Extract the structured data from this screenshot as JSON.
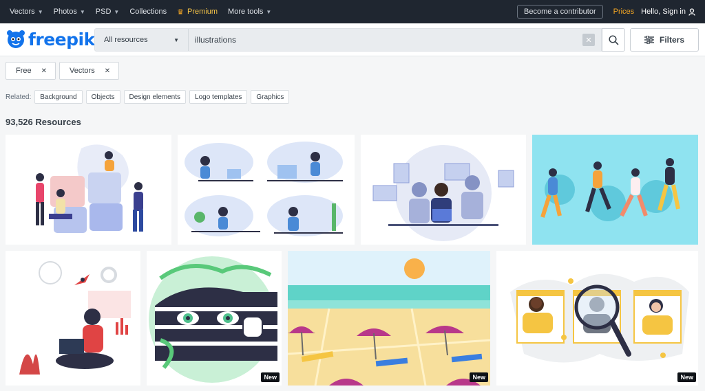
{
  "topnav": {
    "items": [
      {
        "label": "Vectors",
        "dropdown": true
      },
      {
        "label": "Photos",
        "dropdown": true
      },
      {
        "label": "PSD",
        "dropdown": true
      },
      {
        "label": "Collections",
        "dropdown": false
      }
    ],
    "premium_label": "Premium",
    "more_tools_label": "More tools",
    "contributor_label": "Become a contributor",
    "prices_label": "Prices",
    "signin_label": "Hello, Sign in"
  },
  "header": {
    "logo_text": "freepik",
    "resource_select": "All resources",
    "search_value": "illustrations",
    "filters_label": "Filters"
  },
  "chips": [
    {
      "label": "Free"
    },
    {
      "label": "Vectors"
    }
  ],
  "related": {
    "label": "Related:",
    "tags": [
      "Background",
      "Objects",
      "Design elements",
      "Logo templates",
      "Graphics"
    ]
  },
  "results": {
    "count": "93,526 Resources",
    "items": [
      {
        "name": "teamwork-puzzle-illustration",
        "badge": ""
      },
      {
        "name": "people-working-at-desks-illustration",
        "badge": ""
      },
      {
        "name": "remote-video-call-illustration",
        "badge": ""
      },
      {
        "name": "people-jumping-celebration-illustration",
        "badge": ""
      },
      {
        "name": "woman-with-laptop-rocket-illustration",
        "badge": ""
      },
      {
        "name": "girl-peeking-through-leaves-illustration",
        "badge": "New"
      },
      {
        "name": "beach-umbrellas-illustration",
        "badge": "New"
      },
      {
        "name": "job-search-magnifier-illustration",
        "badge": "New"
      }
    ]
  },
  "colors": {
    "brand": "#1273eb",
    "topnav_bg": "#1f2630",
    "premium": "#f7c548",
    "prices": "#f7a823"
  }
}
